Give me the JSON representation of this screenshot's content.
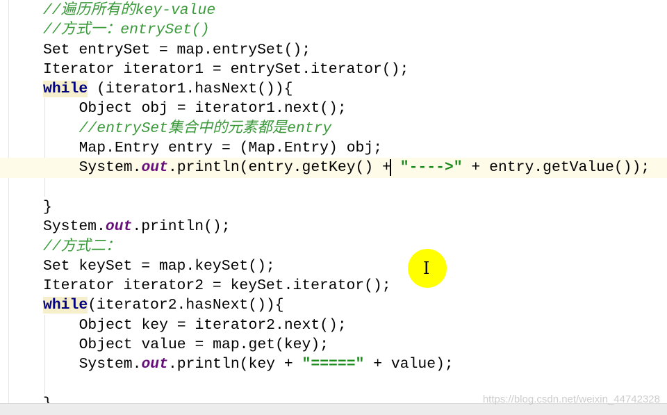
{
  "editor": {
    "lines": [
      {
        "c1": "//遍历所有的key-value"
      },
      {
        "c1": "//方式一：entrySet()"
      },
      {
        "t1": "Set entrySet = map.entrySet();"
      },
      {
        "t1": "Iterator iterator1 = entrySet.iterator();"
      },
      {
        "kw": "while",
        "t1": " (iterator1.hasNext()){"
      },
      {
        "t1": "Object obj = iterator1.next();"
      },
      {
        "c1": "//entrySet集合中的元素都是entry"
      },
      {
        "t1": "Map.Entry entry = (Map.Entry) obj;"
      },
      {
        "t1": "System.",
        "fld": "out",
        "t2": ".println(entry.getKey() +",
        "s": "\"---->\"",
        "t3": " + entry.getValue());"
      },
      {},
      {
        "t1": "}"
      },
      {
        "t1": "System.",
        "fld": "out",
        "t2": ".println();"
      },
      {
        "c1": "//方式二："
      },
      {
        "t1": "Set keySet = map.keySet();"
      },
      {
        "t1": "Iterator iterator2 = keySet.iterator();"
      },
      {
        "kw": "while",
        "t1": "(iterator2.hasNext()){"
      },
      {
        "t1": "Object key = iterator2.next();"
      },
      {
        "t1": "Object value = map.get(key);"
      },
      {
        "t1": "System.",
        "fld": "out",
        "t2": ".println(key + ",
        "s": "\"=====\"",
        "t3": " + value);"
      },
      {},
      {
        "t1": "}"
      }
    ]
  },
  "cursor_icon": "text-ibeam-cursor",
  "highlight_color": "#ffff00",
  "watermark": "https://blog.csdn.net/weixin_44742328"
}
